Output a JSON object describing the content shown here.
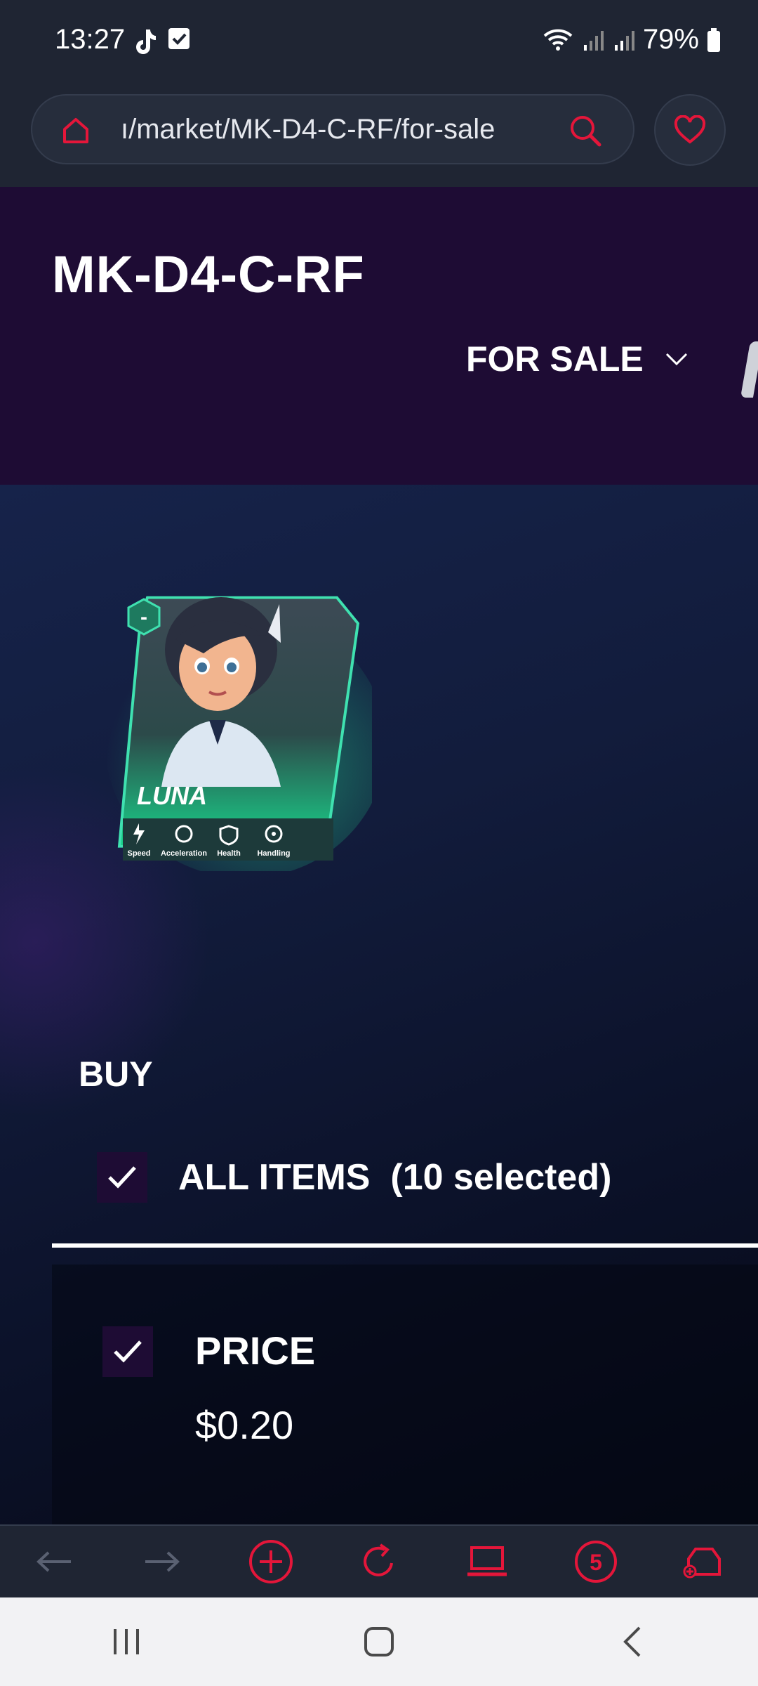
{
  "status_bar": {
    "time": "13:27",
    "battery": "79%",
    "icons": [
      "tiktok-icon",
      "check-square-icon",
      "wifi-icon",
      "signal-icon",
      "signal-icon",
      "battery-icon"
    ]
  },
  "address_bar": {
    "url": "‎…/market/MK-D4-C-RF/for-sale",
    "url_display": "ı/market/MK-D4-C-RF/for-sale"
  },
  "header": {
    "title": "MK-D4-C-RF",
    "status_filter": "FOR SALE"
  },
  "card": {
    "name": "LUNA",
    "level_badge": "-",
    "stats": [
      "Speed",
      "Acceleration",
      "Health",
      "Handling"
    ]
  },
  "buy": {
    "label": "BUY",
    "all_items_label": "ALL ITEMS  (10 selected)",
    "price_label": "PRICE",
    "price_value": "$0.20"
  },
  "toolbar": {
    "tabs_count": "5"
  },
  "colors": {
    "accent": "#e4163a",
    "header_bg": "#1e0c34",
    "card_green": "#1fe08a"
  }
}
